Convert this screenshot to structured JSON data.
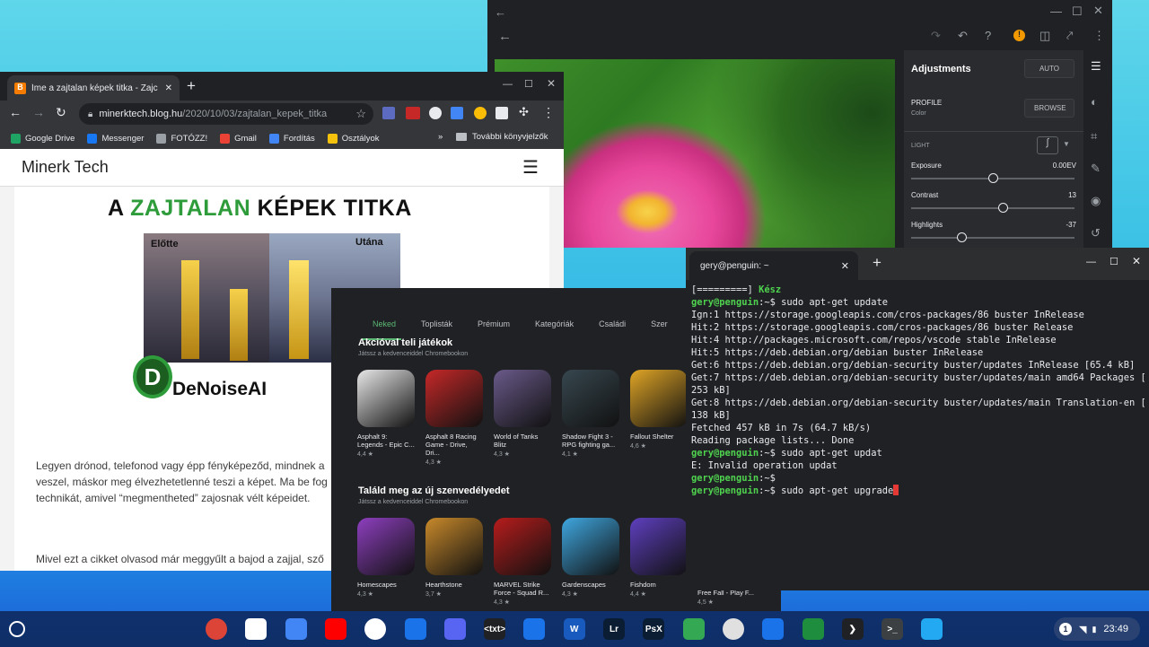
{
  "photo_editor": {
    "panel": {
      "title": "Adjustments",
      "auto_label": "AUTO",
      "profile_label": "PROFILE",
      "profile_value": "Color",
      "browse_label": "BROWSE",
      "light_label": "LIGHT",
      "sliders": [
        {
          "label": "Exposure",
          "value": "0.00EV",
          "level": 0.5
        },
        {
          "label": "Contrast",
          "value": "13",
          "level": 0.56
        },
        {
          "label": "Highlights",
          "value": "-37",
          "level": 0.31
        }
      ]
    }
  },
  "chrome": {
    "tab_title": "Íme a zajtalan képek titka - Zajcs",
    "url_host": "minerktech.blog.hu",
    "url_path": "/2020/10/03/zajtalan_kepek_titka",
    "bookmarks": [
      {
        "label": "Google Drive",
        "color": "#1fa463"
      },
      {
        "label": "Messenger",
        "color": "#1877f2"
      },
      {
        "label": "FOTÓZZ!",
        "color": "#9aa0a6"
      },
      {
        "label": "Gmail",
        "color": "#ea4335"
      },
      {
        "label": "Fordítás",
        "color": "#4285f4"
      },
      {
        "label": "Osztályok",
        "color": "#f4c20d"
      }
    ],
    "other_bookmarks": "További könyvjelzők",
    "site_name": "Minerk Tech",
    "article": {
      "headline_a": "A ",
      "headline_hl": "ZAJTALAN",
      "headline_b": " KÉPEK TITKA",
      "before": "Előtte",
      "after": "Utána",
      "logo_text": "DeNoiseAI",
      "para1": "Legyen drónod, telefonod vagy épp fényképeződ, mindnek a veszel, máskor meg élvezhetetlenné teszi a képet. Ma be fog technikát, amivel “megmentheted” zajosnak vélt képeidet.",
      "para2": "Mivel ezt a cikket olvasod már meggyűlt a bajod a zajjal, sző"
    }
  },
  "play": {
    "tabs": [
      "Neked",
      "Toplisták",
      "Prémium",
      "Kategóriák",
      "Családi",
      "Szer"
    ],
    "sections": [
      {
        "title": "Akcióval teli játékok",
        "subtitle": "Játssz a kedvenceiddel Chromebookon",
        "apps": [
          {
            "name": "Asphalt 9: Legends - Epic C...",
            "rating": "4,4 ★",
            "color": "#e8e8e8"
          },
          {
            "name": "Asphalt 8 Racing Game - Drive, Dri...",
            "rating": "4,3 ★",
            "color": "#c62828"
          },
          {
            "name": "World of Tanks Blitz",
            "rating": "4,3 ★",
            "color": "#6a5a8a"
          },
          {
            "name": "Shadow Fight 3 - RPG fighting ga...",
            "rating": "4,1 ★",
            "color": "#37474f"
          },
          {
            "name": "Fallout Shelter",
            "rating": "4,6 ★",
            "color": "#e0a526"
          }
        ]
      },
      {
        "title": "Találd meg az új szenvedélyedet",
        "subtitle": "Játssz a kedvenceiddel Chromebookon",
        "apps": [
          {
            "name": "Homescapes",
            "rating": "4,3 ★",
            "color": "#8e3fbf"
          },
          {
            "name": "Hearthstone",
            "rating": "3,7 ★",
            "color": "#c98a2b"
          },
          {
            "name": "MARVEL Strike Force - Squad R...",
            "rating": "4,3 ★",
            "color": "#b71c1c"
          },
          {
            "name": "Gardenscapes",
            "rating": "4,3 ★",
            "color": "#3fa7e0"
          },
          {
            "name": "Fishdom",
            "rating": "4,4 ★",
            "color": "#5e3fbf"
          }
        ]
      }
    ],
    "peek": {
      "name": "Free Fall - Play F...",
      "rating": "4,5 ★"
    }
  },
  "terminal": {
    "tab_title": "gery@penguin: ~",
    "prompt_user": "gery@penguin",
    "lines": [
      {
        "type": "plain",
        "text": "[=========] ",
        "extra": "Kész"
      },
      {
        "type": "prompt",
        "text": ":~$ sudo apt-get update"
      },
      {
        "type": "plain",
        "text": "Ign:1 https://storage.googleapis.com/cros-packages/86 buster InRelease"
      },
      {
        "type": "plain",
        "text": "Hit:2 https://storage.googleapis.com/cros-packages/86 buster Release"
      },
      {
        "type": "plain",
        "text": "Hit:4 http://packages.microsoft.com/repos/vscode stable InRelease"
      },
      {
        "type": "plain",
        "text": "Hit:5 https://deb.debian.org/debian buster InRelease"
      },
      {
        "type": "plain",
        "text": "Get:6 https://deb.debian.org/debian-security buster/updates InRelease [65.4 kB]"
      },
      {
        "type": "plain",
        "text": "Get:7 https://deb.debian.org/debian-security buster/updates/main amd64 Packages ["
      },
      {
        "type": "plain",
        "text": "253 kB]"
      },
      {
        "type": "plain",
        "text": "Get:8 https://deb.debian.org/debian-security buster/updates/main Translation-en ["
      },
      {
        "type": "plain",
        "text": "138 kB]"
      },
      {
        "type": "plain",
        "text": "Fetched 457 kB in 7s (64.7 kB/s)"
      },
      {
        "type": "plain",
        "text": "Reading package lists... Done"
      },
      {
        "type": "prompt",
        "text": ":~$ sudo apt-get updat"
      },
      {
        "type": "plain",
        "text": "E: Invalid operation updat"
      },
      {
        "type": "prompt",
        "text": ":~$"
      },
      {
        "type": "prompt",
        "text": ":~$ sudo apt-get upgrade",
        "cursor": true
      }
    ]
  },
  "shelf": {
    "apps": [
      {
        "name": "chrome-icon",
        "color": "#db4437"
      },
      {
        "name": "gmail-icon",
        "color": "#ffffff"
      },
      {
        "name": "docs-icon",
        "color": "#4285f4"
      },
      {
        "name": "youtube-icon",
        "color": "#ff0000"
      },
      {
        "name": "play-store-icon",
        "color": "#ffffff"
      },
      {
        "name": "messages-icon",
        "color": "#1a73e8"
      },
      {
        "name": "discord-icon",
        "color": "#5865f2"
      },
      {
        "name": "text-editor-icon",
        "color": "#202124",
        "label": "<txt>"
      },
      {
        "name": "files-icon",
        "color": "#1a73e8"
      },
      {
        "name": "word-icon",
        "color": "#185abd",
        "label": "W"
      },
      {
        "name": "lightroom-icon",
        "color": "#0b1d33",
        "label": "Lr"
      },
      {
        "name": "photoshop-express-icon",
        "color": "#0b1d33",
        "label": "PsX"
      },
      {
        "name": "settings-gear-icon",
        "color": "#34a853"
      },
      {
        "name": "game-icon",
        "color": "#e0e0e0"
      },
      {
        "name": "gamepad-icon",
        "color": "#1a73e8"
      },
      {
        "name": "classroom-icon",
        "color": "#1e8e3e"
      },
      {
        "name": "launcher-arrow-icon",
        "color": "#202124",
        "label": "❯"
      },
      {
        "name": "terminal-icon",
        "color": "#3c4043",
        "label": ">_"
      },
      {
        "name": "vscode-icon",
        "color": "#23a9f2"
      }
    ],
    "notif_count": "1",
    "time": "23:49"
  }
}
